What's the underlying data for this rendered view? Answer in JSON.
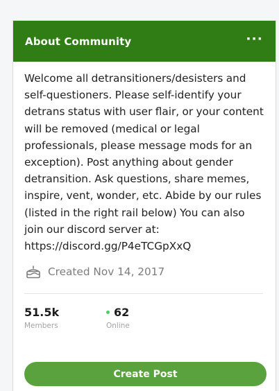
{
  "header": {
    "title": "About Community",
    "more_label": "···"
  },
  "description": "Welcome all detransitioners/desisters and self-questioners. Please self-identify your detrans status with user flair, or your content will be removed (medical or legal professionals, please message mods for an exception). Post anything about gender detransition. Ask questions, share memes, inspire, vent, wonder, etc. Abide by our rules (listed in the right rail below) You can also join our discord server at: https://discord.gg/P4eTCGpXxQ",
  "created": {
    "icon": "cake-icon",
    "text": "Created Nov 14, 2017"
  },
  "stats": {
    "members": {
      "value": "51.5k",
      "label": "Members"
    },
    "online": {
      "value": "62",
      "label": "Online"
    }
  },
  "action": {
    "create_post_label": "Create Post"
  },
  "colors": {
    "header_bg": "#2f7d14",
    "button_bg": "#5aa23d",
    "online_dot": "#46d160"
  }
}
